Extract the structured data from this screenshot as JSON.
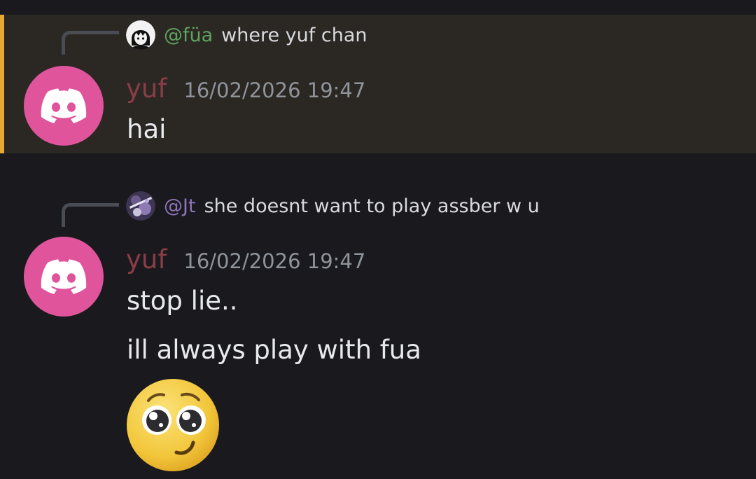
{
  "colors": {
    "background": "#1a1a1e",
    "highlight_background": "#2b2824",
    "highlight_bar": "#e7a934",
    "username": "#8a3d46",
    "mention_fua": "#5ea35f",
    "mention_jt": "#8e74b8",
    "avatar": "#e0549c"
  },
  "messages": [
    {
      "reply": {
        "mention": "@füa",
        "text": "where yuf chan",
        "avatar_icon": "user-avatar-icon"
      },
      "author": "yuf",
      "timestamp": "16/02/2026 19:47",
      "lines": [
        "hai"
      ],
      "avatar_icon": "discord-logo-icon"
    },
    {
      "reply": {
        "mention": "@Jt",
        "text": "she doesnt want to play assber w u",
        "avatar_icon": "user-avatar-icon"
      },
      "author": "yuf",
      "timestamp": "16/02/2026 19:47",
      "lines": [
        "stop lie..",
        "ill always play with fua"
      ],
      "emoji": "pleading-face-emoji",
      "avatar_icon": "discord-logo-icon"
    }
  ]
}
